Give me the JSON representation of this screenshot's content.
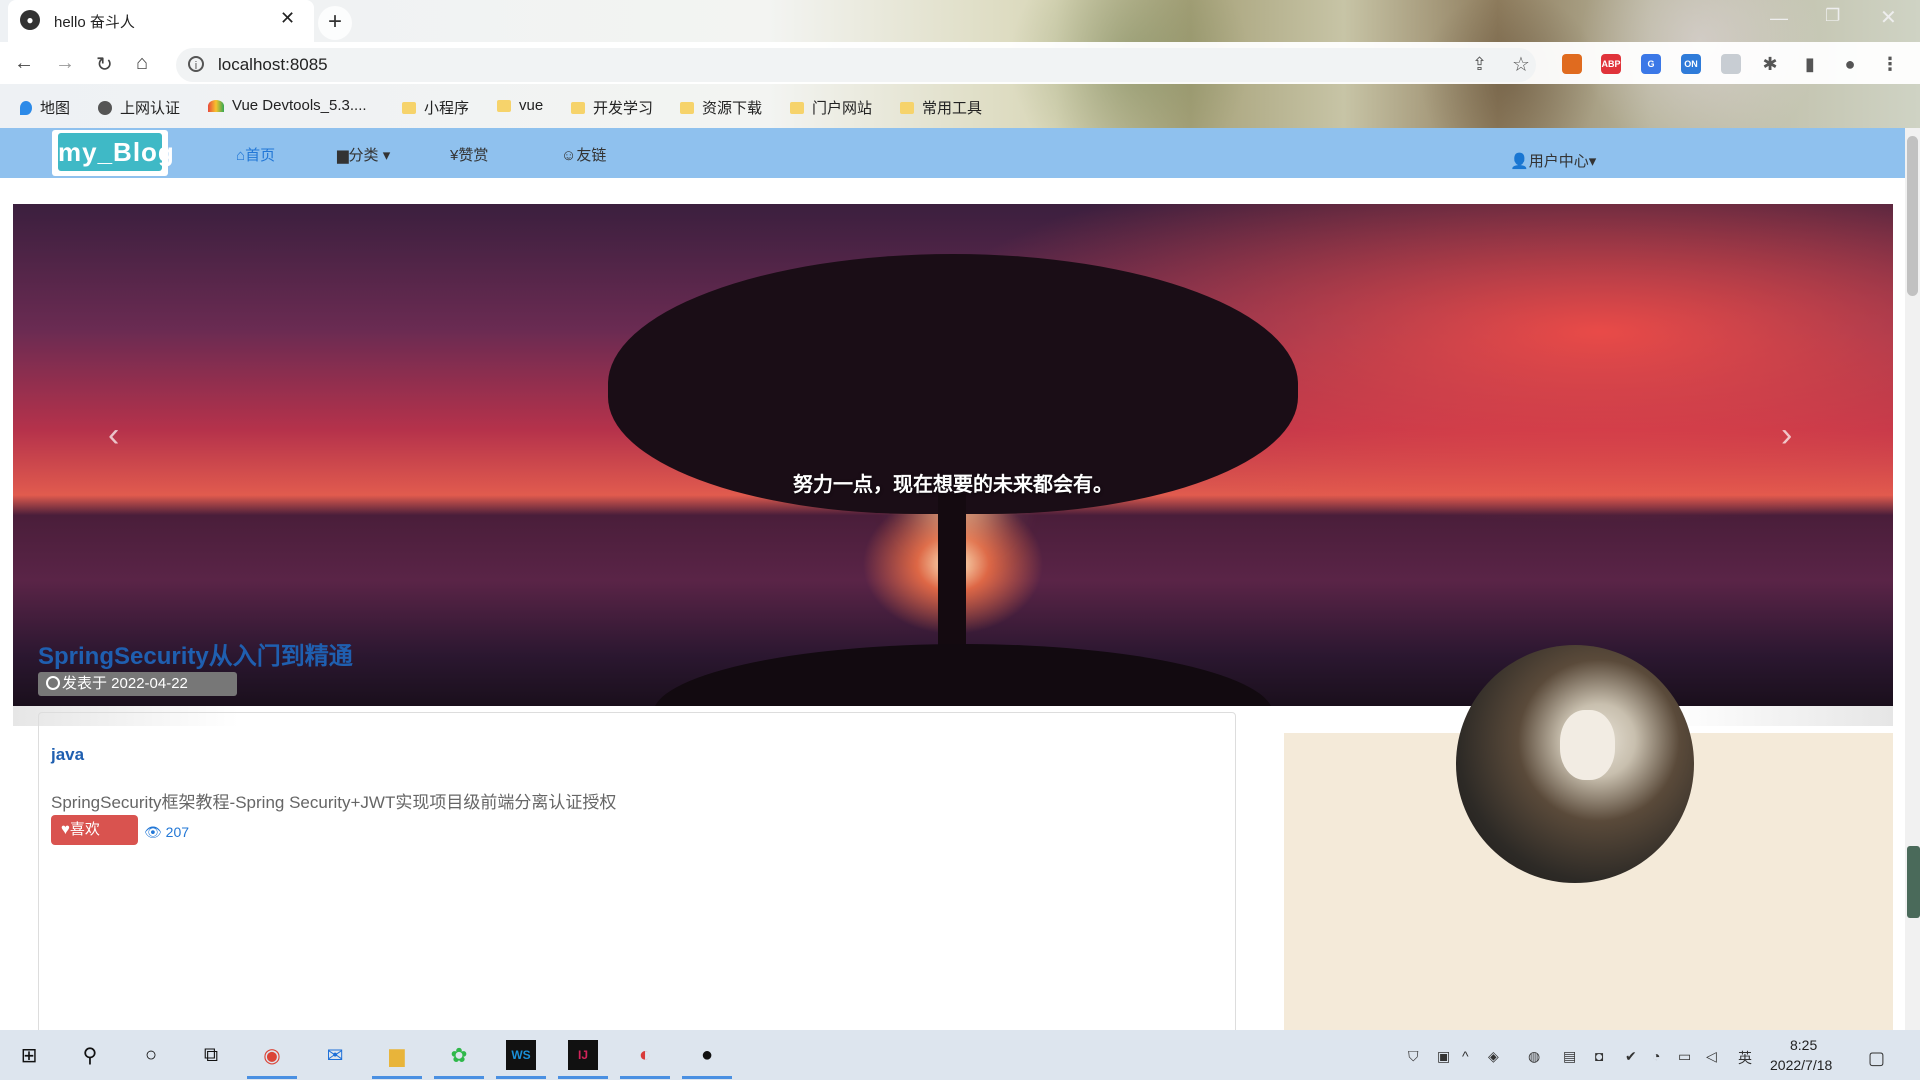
{
  "browser": {
    "tab_title": "hello 奋斗人",
    "tab_close": "✕",
    "new_tab": "+",
    "url": "localhost:8085",
    "window": {
      "minimize": "—",
      "restore": "❐",
      "close": "✕"
    },
    "nav": {
      "back": "←",
      "forward": "→",
      "reload": "↻",
      "home": "⌂"
    },
    "extensions": [
      {
        "name": "firefox-ext",
        "label": "",
        "color": "#e06b1f"
      },
      {
        "name": "abp-ext",
        "label": "ABP",
        "color": "#e0333a"
      },
      {
        "name": "translate-ext",
        "label": "G",
        "color": "#3b78e7"
      },
      {
        "name": "on-ext",
        "label": "ON",
        "color": "#2f7bd9"
      },
      {
        "name": "folder-ext",
        "label": "",
        "color": "#c8cdd3"
      },
      {
        "name": "puzzle-ext",
        "label": "✱",
        "color": "#555555"
      },
      {
        "name": "sidepanel-ext",
        "label": "▮",
        "color": "#555555"
      },
      {
        "name": "profile-ext",
        "label": "●",
        "color": "#555555"
      },
      {
        "name": "menu-ext",
        "label": "⋮",
        "color": "#555555"
      }
    ],
    "bookmarks": [
      {
        "label": "地图",
        "icon": "pin"
      },
      {
        "label": "上网认证",
        "icon": "globe"
      },
      {
        "label": "Vue Devtools_5.3....",
        "icon": "vue"
      },
      {
        "label": "小程序",
        "icon": "folder"
      },
      {
        "label": "vue",
        "icon": "folder"
      },
      {
        "label": "开发学习",
        "icon": "folder"
      },
      {
        "label": "资源下载",
        "icon": "folder"
      },
      {
        "label": "门户网站",
        "icon": "folder"
      },
      {
        "label": "常用工具",
        "icon": "folder"
      }
    ]
  },
  "site": {
    "logo": "my_Blog",
    "nav": {
      "home": "首页",
      "category": "分类",
      "reward": "赞赏",
      "links": "友链",
      "user": "用户中心"
    },
    "carousel": {
      "caption": "努力一点，现在想要的未来都会有。",
      "prev": "‹",
      "next": "›"
    },
    "post": {
      "title": "SpringSecurity从入门到精通",
      "date": "发表于 2022-04-22",
      "category": "java",
      "summary": "SpringSecurity框架教程-Spring Security+JWT实现项目级前端分离认证授权",
      "like": "喜欢",
      "views": "207"
    }
  },
  "taskbar": {
    "time": "8:25",
    "date": "2022/7/18",
    "ime": "英",
    "apps": [
      "start",
      "search",
      "cortana",
      "task-view",
      "chrome",
      "mail",
      "explorer",
      "wechat",
      "webstorm",
      "intellij",
      "app-red",
      "obs"
    ]
  }
}
